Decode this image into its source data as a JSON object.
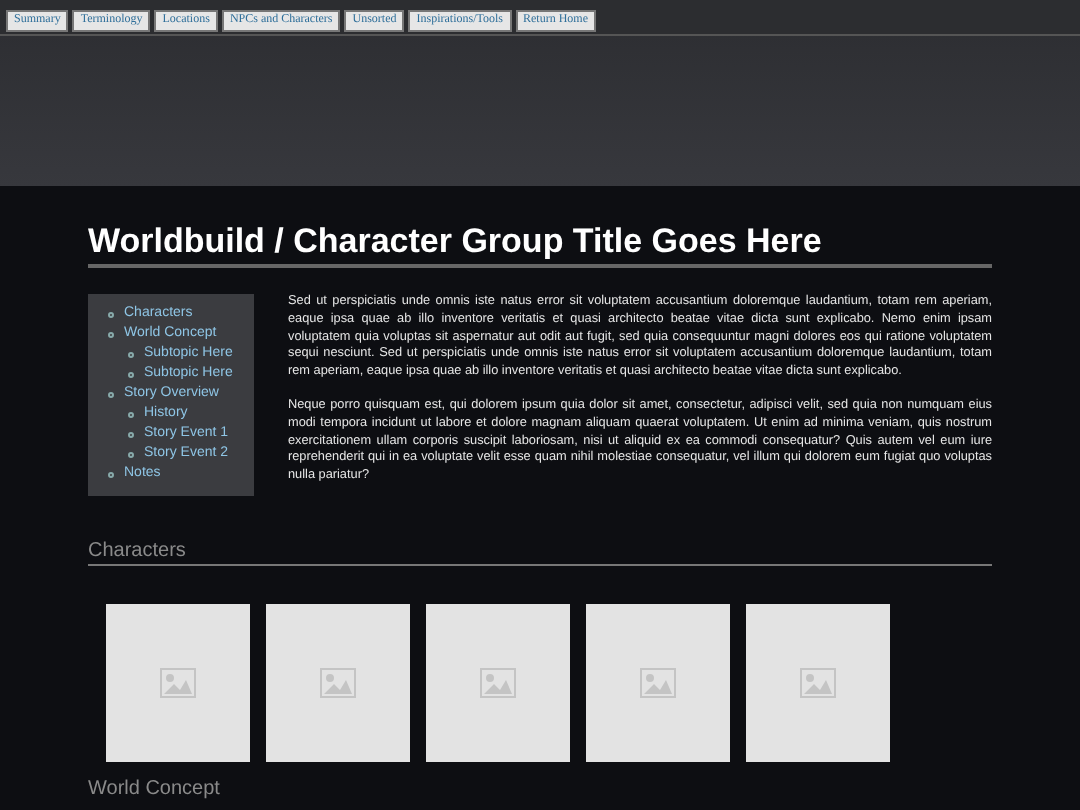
{
  "nav": [
    {
      "label": "Summary"
    },
    {
      "label": "Terminology"
    },
    {
      "label": "Locations"
    },
    {
      "label": "NPCs and Characters"
    },
    {
      "label": "Unsorted"
    },
    {
      "label": "Inspirations/Tools"
    },
    {
      "label": "Return Home"
    }
  ],
  "title": "Worldbuild / Character Group Title Goes Here",
  "toc": [
    {
      "label": "Characters"
    },
    {
      "label": "World Concept",
      "children": [
        {
          "label": "Subtopic Here"
        },
        {
          "label": "Subtopic Here"
        }
      ]
    },
    {
      "label": "Story Overview",
      "children": [
        {
          "label": "History"
        },
        {
          "label": "Story Event 1"
        },
        {
          "label": "Story Event 2"
        }
      ]
    },
    {
      "label": "Notes"
    }
  ],
  "paragraphs": [
    "Sed ut perspiciatis unde omnis iste natus error sit voluptatem accusantium doloremque laudantium, totam rem aperiam, eaque ipsa quae ab illo inventore veritatis et quasi architecto beatae vitae dicta sunt explicabo. Nemo enim ipsam voluptatem quia voluptas sit aspernatur aut odit aut fugit, sed quia consequuntur magni dolores eos qui ratione voluptatem sequi nesciunt. Sed ut perspiciatis unde omnis iste natus error sit voluptatem accusantium doloremque laudantium, totam rem aperiam, eaque ipsa quae ab illo inventore veritatis et quasi architecto beatae vitae dicta sunt explicabo.",
    "Neque porro quisquam est, qui dolorem ipsum quia dolor sit amet, consectetur, adipisci velit, sed quia non numquam eius modi tempora incidunt ut labore et dolore magnam aliquam quaerat voluptatem. Ut enim ad minima veniam, quis nostrum exercitationem ullam corporis suscipit laboriosam, nisi ut aliquid ex ea commodi consequatur? Quis autem vel eum iure reprehenderit qui in ea voluptate velit esse quam nihil molestiae consequatur, vel illum qui dolorem eum fugiat quo voluptas nulla pariatur?"
  ],
  "characters": {
    "heading": "Characters",
    "images": [
      {
        "kind": "placeholder"
      },
      {
        "kind": "placeholder"
      },
      {
        "kind": "placeholder"
      },
      {
        "kind": "placeholder"
      },
      {
        "kind": "placeholder"
      }
    ]
  },
  "next_heading": "World Concept"
}
